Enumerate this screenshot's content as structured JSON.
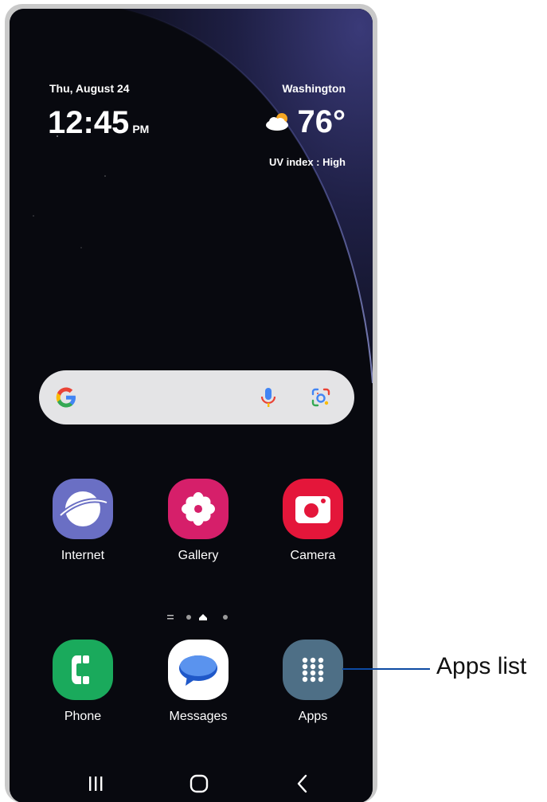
{
  "status": {
    "date": "Thu, August 24",
    "time": "12:45",
    "ampm": "PM",
    "location": "Washington",
    "temperature": "76°",
    "uv_index": "UV index : High",
    "weather_icon": "partly-cloudy-icon"
  },
  "search": {
    "icons": [
      "google-g-icon",
      "microphone-icon",
      "google-lens-icon"
    ]
  },
  "apps_row1": [
    {
      "label": "Internet",
      "icon": "samsung-internet-icon",
      "color": "#6a6fc4"
    },
    {
      "label": "Gallery",
      "icon": "gallery-flower-icon",
      "color": "#d61f6a"
    },
    {
      "label": "Camera",
      "icon": "camera-icon",
      "color": "#e4163a"
    }
  ],
  "dock": [
    {
      "label": "Phone",
      "icon": "phone-icon",
      "color": "#1aaa5c"
    },
    {
      "label": "Messages",
      "icon": "messages-icon",
      "color": "#ffffff"
    },
    {
      "label": "Apps",
      "icon": "apps-grid-icon",
      "color": "#4e6f86"
    }
  ],
  "nav": [
    "recents-icon",
    "home-icon",
    "back-icon"
  ],
  "callout": {
    "text": "Apps list",
    "line_color": "#0d4aa3"
  }
}
